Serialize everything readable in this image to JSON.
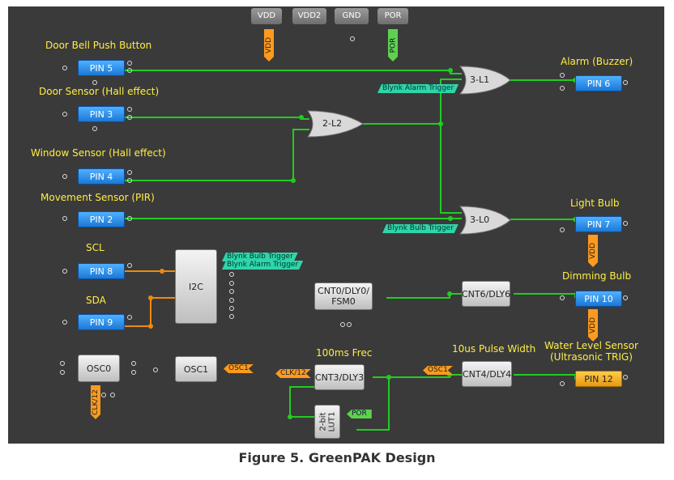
{
  "caption": "Figure 5. GreenPAK Design",
  "power": {
    "vdd": "VDD",
    "vdd2": "VDD2",
    "gnd": "GND",
    "por": "POR"
  },
  "power_tags": {
    "vdd": "VDD",
    "por": "POR"
  },
  "inputs": [
    {
      "label": "Door Bell Push Button",
      "pin": "PIN 5"
    },
    {
      "label": "Door Sensor (Hall effect)",
      "pin": "PIN 3"
    },
    {
      "label": "Window Sensor (Hall effect)",
      "pin": "PIN 4"
    },
    {
      "label": "Movement Sensor (PIR)",
      "pin": "PIN 2"
    },
    {
      "label": "SCL",
      "pin": "PIN 8"
    },
    {
      "label": "SDA",
      "pin": "PIN 9"
    }
  ],
  "outputs": [
    {
      "label": "Alarm (Buzzer)",
      "pin": "PIN 6"
    },
    {
      "label": "Light Bulb",
      "pin": "PIN 7"
    },
    {
      "label": "Dimming Bulb",
      "pin": "PIN 10"
    },
    {
      "label": "Water Level Sensor\n(Ultrasonic TRIG)",
      "pin": "PIN 12"
    }
  ],
  "output_tags": {
    "pin7_vdd": "VDD",
    "pin10_vdd": "VDD"
  },
  "gates": {
    "or_alarm": "3-L1",
    "or_door": "2-L2",
    "or_light": "3-L0"
  },
  "blocks": {
    "i2c": "I2C",
    "cnt0": "CNT0/DLY0/\nFSM0",
    "cnt6": "CNT6/DLY6",
    "osc0": "OSC0",
    "osc1": "OSC1",
    "cnt3": "CNT3/DLY3",
    "cnt4": "CNT4/DLY4",
    "lut1": "2-bit\nLUT1"
  },
  "block_labels": {
    "cnt3": "100ms Frec",
    "cnt4": "10us Pulse Width"
  },
  "tags": {
    "blynk_alarm_trigger": "Blynk Alarm Trigger",
    "blynk_bulb_trigger": "Blynk Bulb Trigger",
    "i2c_bulb": "Blynk Bulb Trigger",
    "i2c_alarm": "Blynk Alarm Trigger",
    "osc1_out": "OSC1",
    "clk12_in": "CLK/12",
    "osc1_in": "OSC1",
    "por_in": "POR",
    "clk12_osc0": "CLK/12"
  },
  "colors": {
    "canvas": "#3a3a3a",
    "wire_green": "#22cc22",
    "wire_orange": "#ee8a10",
    "label_yellow": "#ffee44",
    "pin_blue": "#2a8ee8",
    "pin_orange": "#f0aa22"
  }
}
